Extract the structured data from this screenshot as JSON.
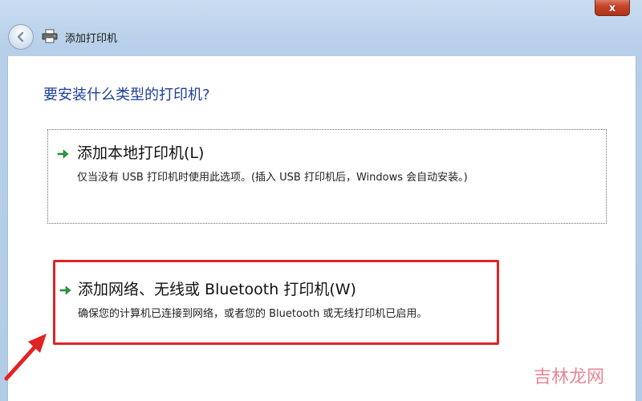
{
  "window": {
    "close_label": "x",
    "title": "添加打印机"
  },
  "icons": {
    "back": "back-arrow-icon",
    "printer": "printer-icon",
    "option_arrow": "green-arrow-icon"
  },
  "main": {
    "question": "要安装什么类型的打印机?",
    "options": [
      {
        "title": "添加本地打印机(L)",
        "description": "仅当没有 USB 打印机时使用此选项。(插入 USB 打印机后，Windows 会自动安装。)"
      },
      {
        "title": "添加网络、无线或 Bluetooth 打印机(W)",
        "description": "确保您的计算机已连接到网络，或者您的 Bluetooth 或无线打印机已启用。"
      }
    ]
  },
  "annotation": {
    "highlight_color": "#e02424"
  },
  "watermark": "吉林龙网"
}
